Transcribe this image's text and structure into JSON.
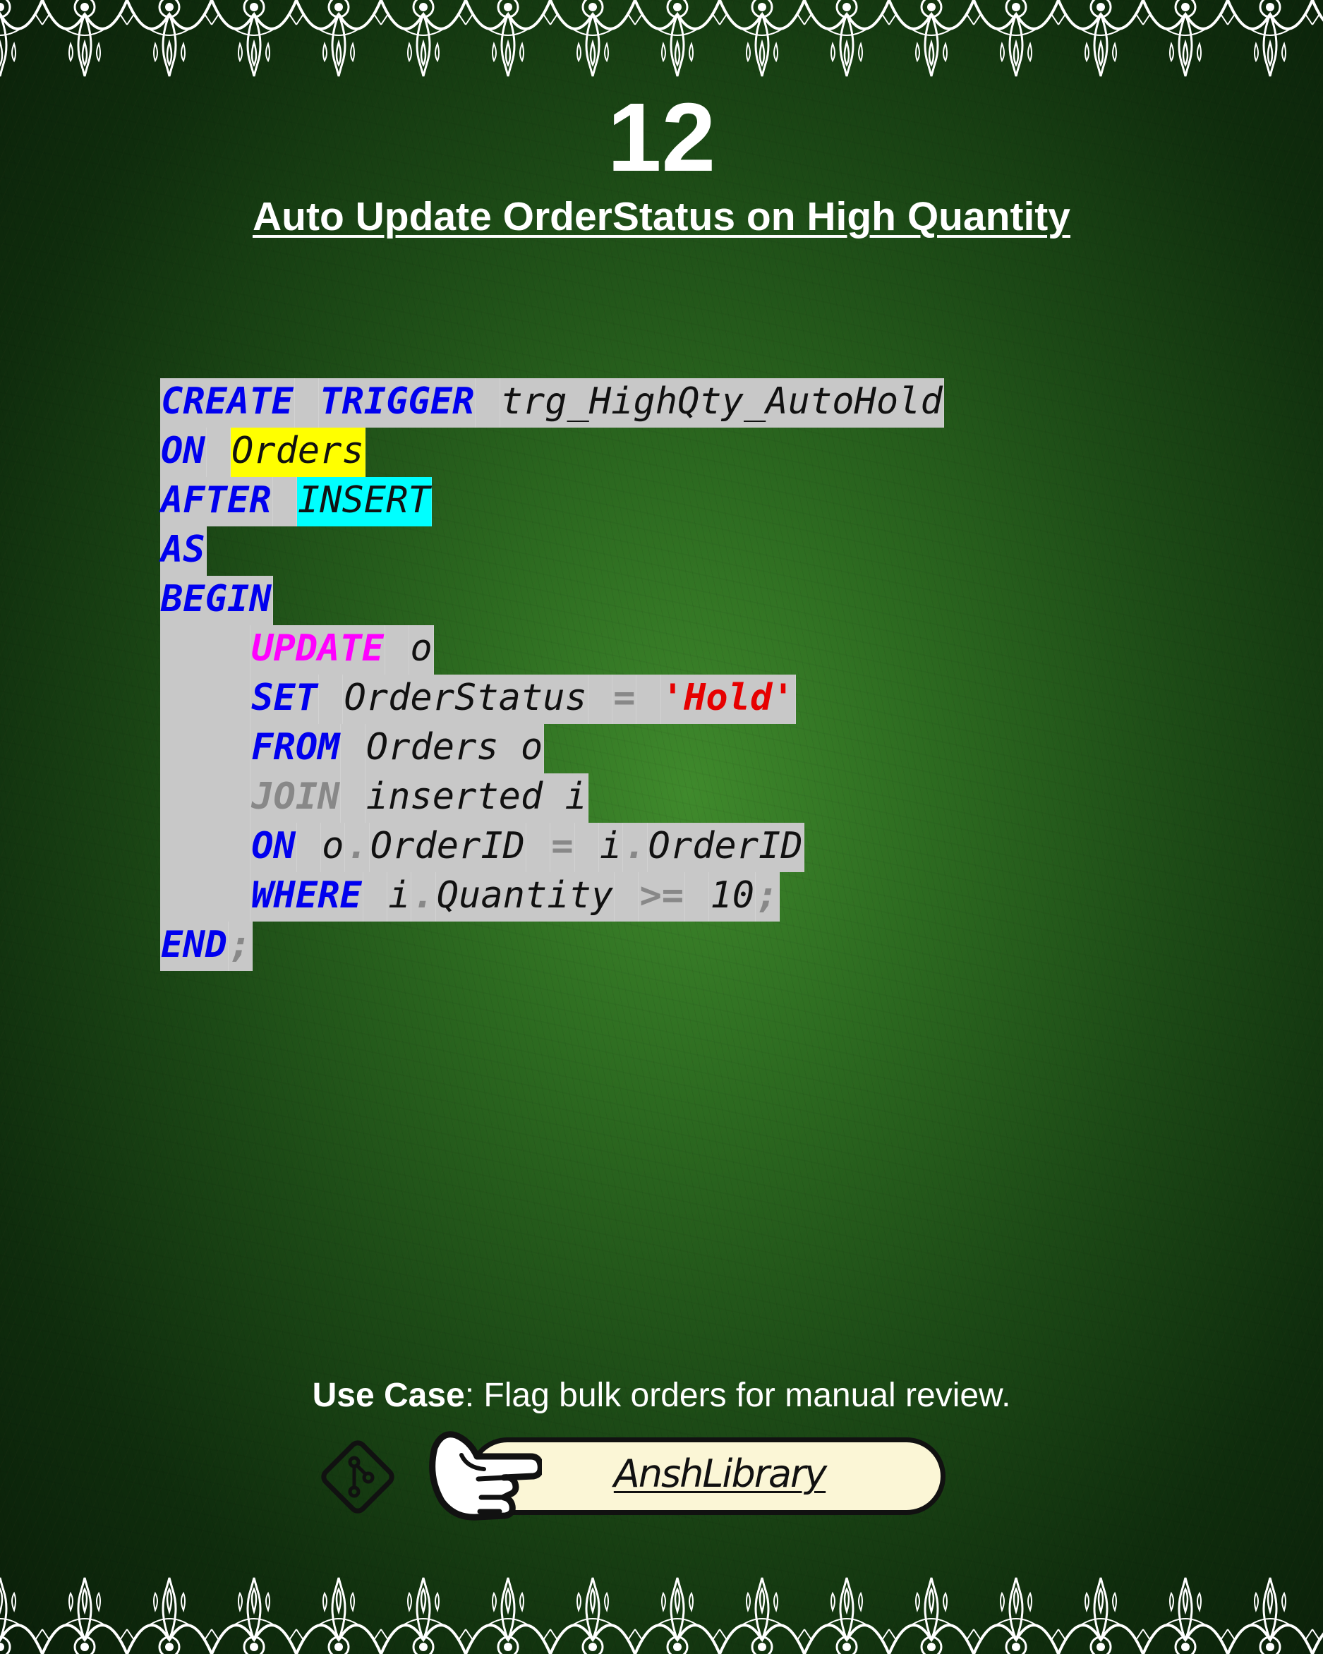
{
  "slide": {
    "number": "12",
    "title": "Auto Update OrderStatus on High Quantity"
  },
  "code": {
    "lines": [
      [
        "CREATE",
        " ",
        "TRIGGER",
        " ",
        "trg_HighQty_AutoHold"
      ],
      [
        "ON",
        " ",
        "Orders"
      ],
      [
        "AFTER",
        " ",
        "INSERT"
      ],
      [
        "AS"
      ],
      [
        "BEGIN"
      ],
      [
        "    ",
        "UPDATE",
        " ",
        "o"
      ],
      [
        "    ",
        "SET",
        " ",
        "OrderStatus",
        " ",
        "=",
        " ",
        "'Hold'"
      ],
      [
        "    ",
        "FROM",
        " ",
        "Orders o"
      ],
      [
        "    ",
        "JOIN",
        " ",
        "inserted i"
      ],
      [
        "    ",
        "ON",
        " ",
        "o",
        ".",
        "OrderID",
        " ",
        "=",
        " ",
        "i",
        ".",
        "OrderID"
      ],
      [
        "    ",
        "WHERE",
        " ",
        "i",
        ".",
        "Quantity",
        " ",
        ">=",
        " ",
        "10",
        ";"
      ],
      [
        "END",
        ";"
      ]
    ]
  },
  "use_case": {
    "label": "Use Case",
    "text": ": Flag bulk orders for manual review."
  },
  "footer": {
    "brand": "AnshLibrary"
  },
  "colors": {
    "keyword": "#0000ee",
    "string": "#e60000",
    "update_keyword": "#ff00ff",
    "table_highlight": "#ffff00",
    "insert_highlight": "#00ffff",
    "code_background": "#c8c8c8"
  },
  "icons": [
    "git-branch-icon",
    "pointing-hand-icon",
    "ornamental-border"
  ]
}
